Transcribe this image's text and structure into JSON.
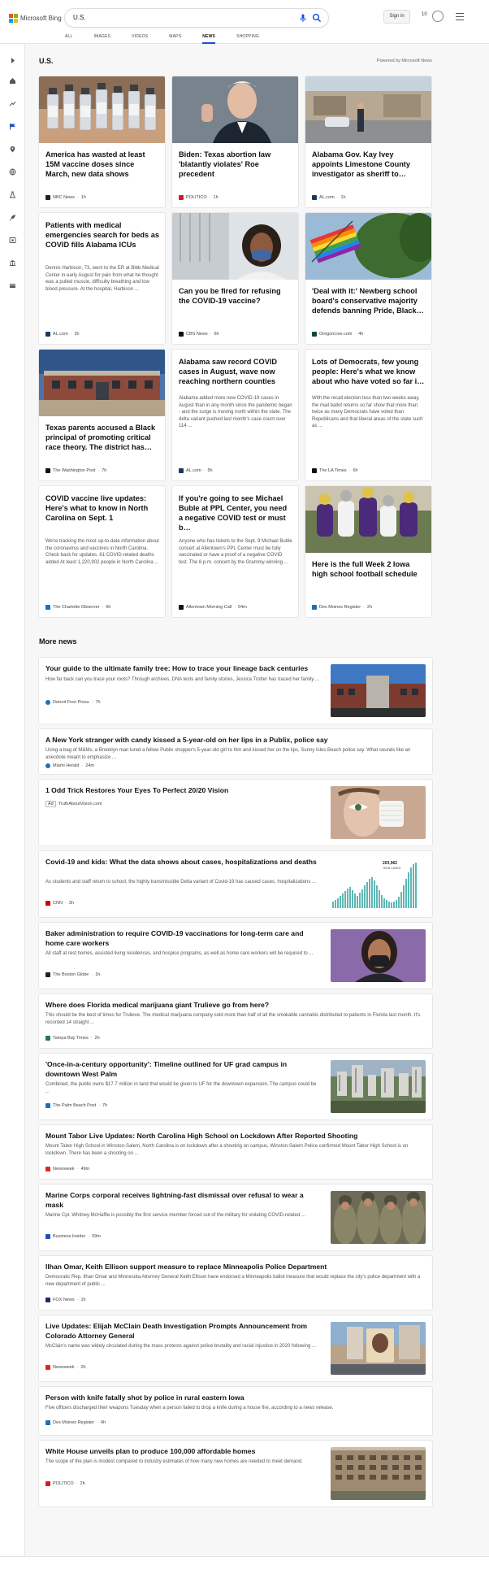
{
  "header": {
    "brand": "Microsoft Bing",
    "search_value": "U.S.",
    "sign_in": "Sign in",
    "rewards_count": "10",
    "tabs": [
      {
        "label": "ALL"
      },
      {
        "label": "IMAGES"
      },
      {
        "label": "VIDEOS"
      },
      {
        "label": "MAPS"
      },
      {
        "label": "NEWS"
      },
      {
        "label": "SHOPPING"
      }
    ],
    "active_tab": "NEWS"
  },
  "section": {
    "title": "U.S.",
    "powered_by": "Powered by Microsoft News"
  },
  "cards": [
    {
      "title": "America has wasted at least 15M vaccine doses since March, new data shows",
      "snippet": "",
      "source": "NBC News",
      "age": "1h",
      "fav_color": "#222"
    },
    {
      "title": "Biden: Texas abortion law 'blatantly violates' Roe precedent",
      "snippet": "",
      "source": "POLITICO",
      "age": "1h",
      "fav_color": "#d51c2b"
    },
    {
      "title": "Alabama Gov. Kay Ivey appoints Limestone County investigator as sheriff to…",
      "snippet": "",
      "source": "AL.com",
      "age": "1h",
      "fav_color": "#1a3a5c"
    },
    {
      "title": "Patients with medical emergencies search for beds as COVID fills Alabama ICUs",
      "snippet": "Dennis Harbison, 73, went to the ER at Bibb Medical Center in early August for pain from what he thought was a pulled muscle, difficulty breathing and low blood pressure. At the hospital, Harbison ...",
      "source": "AL.com",
      "age": "2h",
      "fav_color": "#1a3a5c"
    },
    {
      "title": "Can you be fired for refusing the COVID-19 vaccine?",
      "snippet": "",
      "source": "CBS News",
      "age": "6h",
      "fav_color": "#111"
    },
    {
      "title": "'Deal with it:' Newberg school board's conservative majority defends banning Pride, Black…",
      "snippet": "",
      "source": "OregonLive.com",
      "age": "4h",
      "fav_color": "#0a4d2c"
    },
    {
      "title": "Texas parents accused a Black principal of promoting critical race theory. The district has…",
      "snippet": "",
      "source": "The Washington Post",
      "age": "7h",
      "fav_color": "#111"
    },
    {
      "title": "Alabama saw record COVID cases in August, wave now reaching northern counties",
      "snippet": "Alabama added more new COVID-19 cases in August than in any month since the pandemic began - and the surge is moving north within the state. The delta variant pushed last month's case count over 114 ...",
      "source": "AL.com",
      "age": "5h",
      "fav_color": "#1a3a5c"
    },
    {
      "title": "Lots of Democrats, few young people: Here's what we know about who have voted so far i…",
      "snippet": "With the recall election less than two weeks away, the mail ballot returns so far show that more than twice as many Democrats have voted than Republicans and that liberal areas of the state such as ...",
      "source": "The LA Times",
      "age": "6h",
      "fav_color": "#111"
    },
    {
      "title": "COVID vaccine live updates: Here's what to know in North Carolina on Sept. 1",
      "snippet": "We're tracking the most up-to-date information about the coronavirus and vaccines in North Carolina. Check back for updates. 61 COVID-related deaths added At least 1,220,902 people in North Carolina ...",
      "source": "The Charlotte Observer",
      "age": "6h",
      "fav_color": "#1d6fb8"
    },
    {
      "title": "If you're going to see Michael Buble at PPL Center, you need a negative COVID test or must b…",
      "snippet": "Anyone who has tickets to the Sept. 9 Michael Buble concert at Allentown's PPL Center must be fully vaccinated or have a proof of a negative COVID test. The 8 p.m. concert by the Grammy-winning ...",
      "source": "Allentown Morning Call",
      "age": "54m",
      "fav_color": "#111"
    },
    {
      "title": "Here is the full Week 2 Iowa high school football schedule",
      "snippet": "",
      "source": "Des Moines Register",
      "age": "2h",
      "fav_color": "#1d6fb8"
    }
  ],
  "more_news": {
    "title": "More news",
    "items": [
      {
        "title": "Your guide to the ultimate family tree: How to trace your lineage back centuries",
        "snippet": "How far back can you trace your roots? Through archives, DNA tests and family stories, Jessica Trotter has traced her family ...",
        "source": "Detroit Free Press",
        "age": "7h",
        "ad": "",
        "fav_color": "#1d6fb8"
      },
      {
        "title": "A New York stranger with candy kissed a 5-year-old on her lips in a Publix, police say",
        "snippet": "Using a bag of M&Ms, a Brooklyn man lured a fellow Publix shopper's 5-year-old girl to him and kissed her on the lips, Sunny Isles Beach police say. What sounds like an anecdote meant to emphasize ...",
        "source": "Miami Herald",
        "age": "24m",
        "ad": "",
        "fav_color": "#1d6fb8"
      },
      {
        "title": "1 Odd Trick Restores Your Eyes To Perfect 20/20 Vision",
        "snippet": "",
        "source": "TruthAboutVision.com",
        "age": "",
        "ad": "Ad",
        "fav_color": "#fff"
      },
      {
        "title": "Covid-19 and kids: What the data shows about cases, hospitalizations and deaths",
        "snippet": "As students and staff return to school, the highly transmissible Delta variant of Covid-19 has caused cases, hospitalizations ...",
        "source": "CNN",
        "age": "3h",
        "ad": "",
        "fav_color": "#cc0000",
        "thumb_caption": "203,962",
        "thumb_caption2": "TEEN CASES"
      },
      {
        "title": "Baker administration to require COVID-19 vaccinations for long-term care and home care workers",
        "snippet": "All staff at rest homes, assisted living residences, and hospice programs, as well as home care workers will be required to ...",
        "source": "The Boston Globe",
        "age": "1h",
        "ad": "",
        "fav_color": "#222"
      },
      {
        "title": "Where does Florida medical marijuana giant Trulieve go from here?",
        "snippet": "This should be the best of times for Trulieve. The medical marijuana company sold more than half of all the smokable cannabis distributed to patients in Florida last month. It's recorded 14 straight ...",
        "source": "Tampa Bay Times",
        "age": "2h",
        "ad": "",
        "fav_color": "#1f7a4a"
      },
      {
        "title": "'Once-in-a-century opportunity': Timeline outlined for UF grad campus in downtown West Palm",
        "snippet": "Combined, the public owns $17.7 million in land that would be given to UF for the downtown expansion. The campus could be ...",
        "source": "The Palm Beach Post",
        "age": "7h",
        "ad": "",
        "fav_color": "#1d6fb8"
      },
      {
        "title": "Mount Tabor Live Updates: North Carolina High School on Lockdown After Reported Shooting",
        "snippet": "Mount Tabor High School in Winston-Salem, North Carolina is on lockdown after a shooting on campus, Winston-Salem Police confirmed Mount Tabor High School is on lockdown. There has been a shooting on ...",
        "source": "Newsweek",
        "age": "49m",
        "ad": "",
        "fav_color": "#e02424"
      },
      {
        "title": "Marine Corps corporal receives lightning-fast dismissal over refusal to wear a mask",
        "snippet": "Marine Cpl. Whitney McHaffie is possibly the first service member forced out of the military for violating COVID-related ...",
        "source": "Business Insider",
        "age": "59m",
        "ad": "",
        "fav_color": "#1d4fb8"
      },
      {
        "title": "Ilhan Omar, Keith Ellison support measure to replace Minneapolis Police Department",
        "snippet": "Democratic Rep. Ilhan Omar and Minnesota Attorney General Keith Ellison have endorsed a Minneapolis ballot measure that would replace the city's police department with a new department of public ...",
        "source": "FOX News",
        "age": "1h",
        "ad": "",
        "fav_color": "#1b2f5c"
      },
      {
        "title": "Live Updates: Elijah McClain Death Investigation Prompts Announcement from Colorado Attorney General",
        "snippet": "McClain's name was widely circulated during the mass protests against police brutality and racial injustice in 2020 following ...",
        "source": "Newsweek",
        "age": "2h",
        "ad": "",
        "fav_color": "#e02424"
      },
      {
        "title": "Person with knife fatally shot by police in rural eastern Iowa",
        "snippet": "Five officers discharged their weapons Tuesday when a person failed to drop a knife during a house fire, according to a news release.",
        "source": "Des Moines Register",
        "age": "4h",
        "ad": "",
        "fav_color": "#1d6fb8"
      },
      {
        "title": "White House unveils plan to produce 100,000 affordable homes",
        "snippet": "The scope of the plan is modest compared to industry estimates of how many new homes are needed to meet demand.",
        "source": "POLITICO",
        "age": "2h",
        "ad": "",
        "fav_color": "#d51c2b"
      }
    ]
  }
}
